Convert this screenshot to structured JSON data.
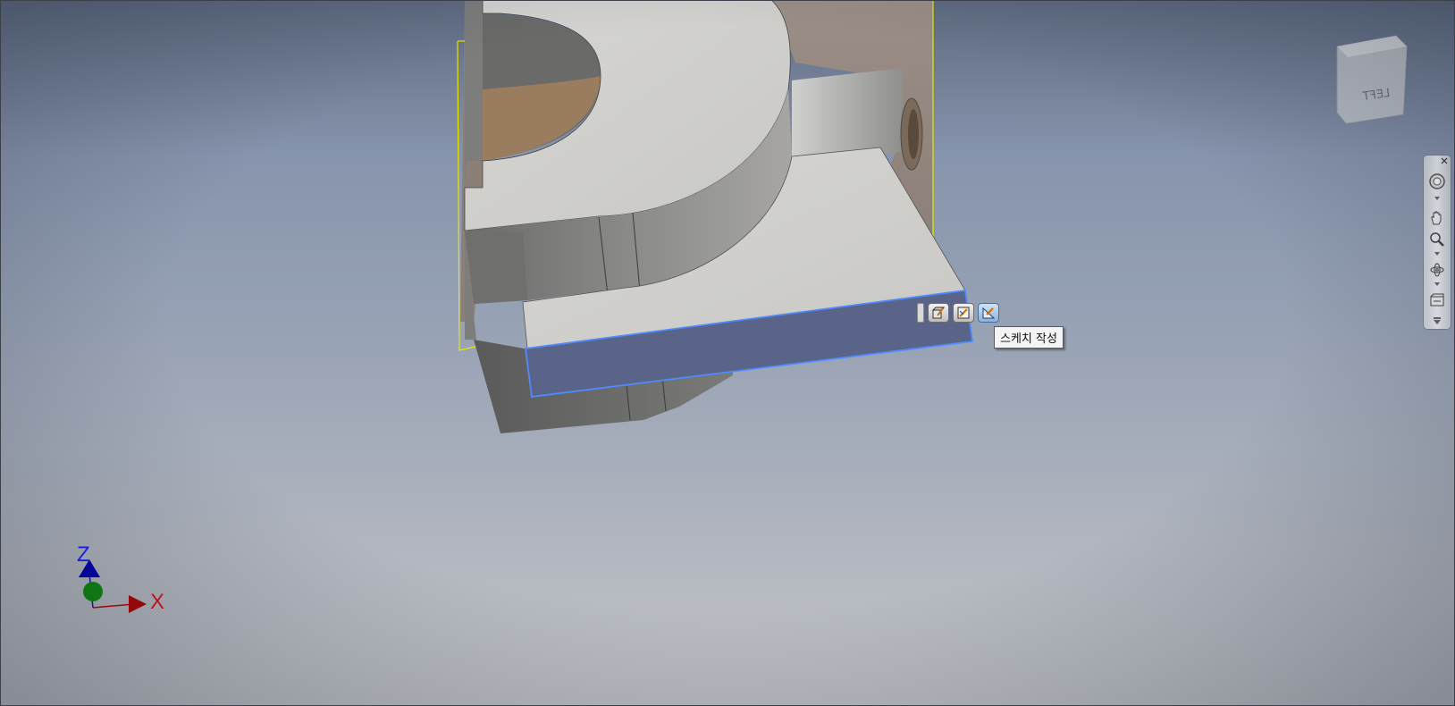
{
  "viewport": {
    "mini_toolbar": {
      "buttons": [
        {
          "icon": "edit-extrude-icon"
        },
        {
          "icon": "edit-sketch-icon"
        },
        {
          "icon": "create-sketch-icon",
          "active": true
        }
      ],
      "tooltip": "스케치 작성"
    },
    "navigation_bar": {
      "items": [
        "full-navigation-wheel-icon",
        "pan-hand-icon",
        "zoom-icon",
        "orbit-icon",
        "look-at-icon"
      ]
    },
    "view_cube": {
      "face_label": "LEFT"
    },
    "triad": {
      "z_label": "Z",
      "x_label": "X",
      "z_color": "#1a1aff",
      "x_color": "#e01010"
    },
    "colors": {
      "selection_face": "#5a6488",
      "selection_edge": "#4d8bff",
      "bounding_box": "#e8e800"
    }
  }
}
